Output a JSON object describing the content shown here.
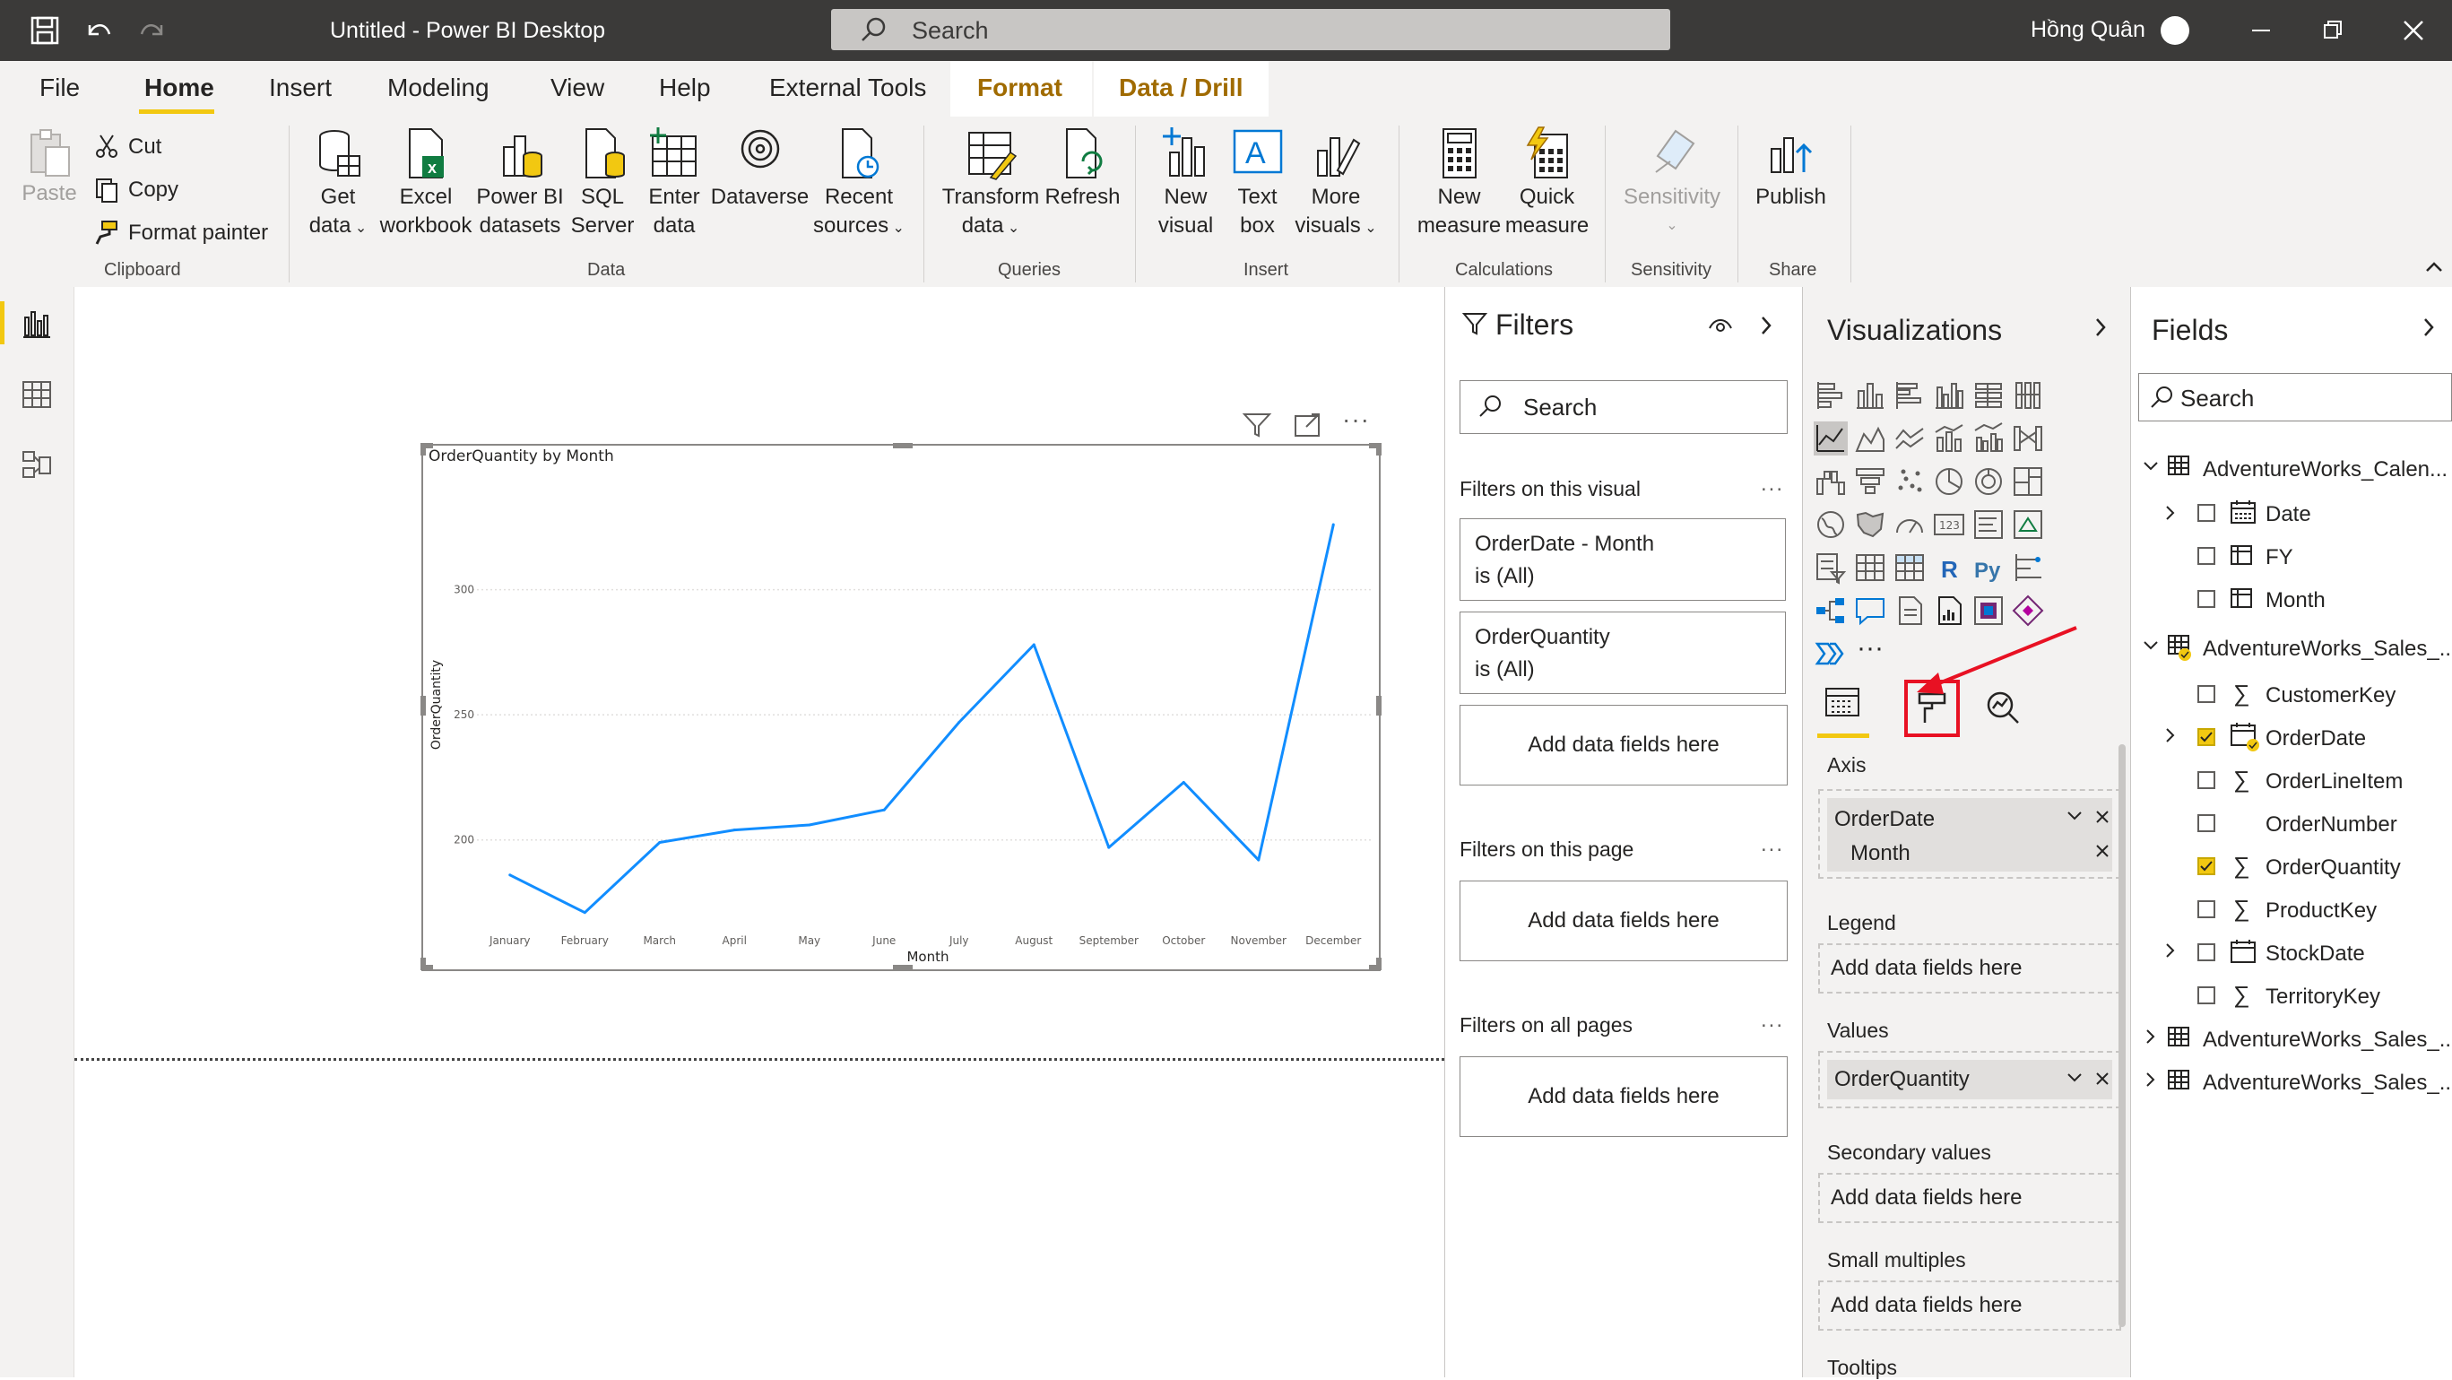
{
  "titlebar": {
    "title": "Untitled - Power BI Desktop",
    "search_placeholder": "Search",
    "user": "Hồng Quân"
  },
  "menu": {
    "tabs": [
      "File",
      "Home",
      "Insert",
      "Modeling",
      "View",
      "Help",
      "External Tools",
      "Format",
      "Data / Drill"
    ],
    "active": "Home"
  },
  "ribbon": {
    "clipboard": {
      "paste": "Paste",
      "cut": "Cut",
      "copy": "Copy",
      "format_painter": "Format painter",
      "group": "Clipboard"
    },
    "data": {
      "get_data_1": "Get",
      "get_data_2": "data",
      "excel_1": "Excel",
      "excel_2": "workbook",
      "pbi_1": "Power BI",
      "pbi_2": "datasets",
      "sql_1": "SQL",
      "sql_2": "Server",
      "enter_1": "Enter",
      "enter_2": "data",
      "dataverse": "Dataverse",
      "recent_1": "Recent",
      "recent_2": "sources",
      "group": "Data"
    },
    "queries": {
      "transform_1": "Transform",
      "transform_2": "data",
      "refresh": "Refresh",
      "group": "Queries"
    },
    "insert": {
      "new_1": "New",
      "new_2": "visual",
      "text_1": "Text",
      "text_2": "box",
      "more_1": "More",
      "more_2": "visuals",
      "group": "Insert"
    },
    "calculations": {
      "new_1": "New",
      "new_2": "measure",
      "quick_1": "Quick",
      "quick_2": "measure",
      "group": "Calculations"
    },
    "sensitivity": {
      "label": "Sensitivity",
      "group": "Sensitivity"
    },
    "share": {
      "publish": "Publish",
      "group": "Share"
    }
  },
  "chart_data": {
    "type": "line",
    "title": "OrderQuantity by Month",
    "xlabel": "Month",
    "ylabel": "OrderQuantity",
    "categories": [
      "January",
      "February",
      "March",
      "April",
      "May",
      "June",
      "July",
      "August",
      "September",
      "October",
      "November",
      "December"
    ],
    "series": [
      {
        "values": [
          186,
          171,
          199,
          204,
          206,
          212,
          247,
          278,
          197,
          223,
          192,
          326
        ]
      }
    ],
    "yticks": [
      200,
      250,
      300
    ],
    "ylim": [
      163,
      345
    ],
    "color": "#118dff"
  },
  "filters": {
    "title": "Filters",
    "search_placeholder": "Search",
    "on_visual": "Filters on this visual",
    "card1_line1": "OrderDate - Month",
    "card1_line2": "is (All)",
    "card2_line1": "OrderQuantity",
    "card2_line2": "is (All)",
    "add_fields": "Add data fields here",
    "on_page": "Filters on this page",
    "on_all": "Filters on all pages",
    "more": "..."
  },
  "visualizations": {
    "title": "Visualizations",
    "axis": "Axis",
    "axis_field": "OrderDate",
    "axis_sub": "Month",
    "legend": "Legend",
    "values": "Values",
    "values_field": "OrderQuantity",
    "secondary": "Secondary values",
    "small_multiples": "Small multiples",
    "tooltips": "Tooltips",
    "add_fields": "Add data fields here",
    "r_label": "R",
    "py_label": "Py",
    "num_label": "123"
  },
  "fields": {
    "title": "Fields",
    "search_placeholder": "Search",
    "tables": [
      {
        "name": "AdventureWorks_Calen...",
        "items": [
          "Date",
          "FY",
          "Month"
        ]
      },
      {
        "name": "AdventureWorks_Sales_...",
        "items": [
          "CustomerKey",
          "OrderDate",
          "OrderLineItem",
          "OrderNumber",
          "OrderQuantity",
          "ProductKey",
          "StockDate",
          "TerritoryKey"
        ]
      },
      {
        "name": "AdventureWorks_Sales_..."
      },
      {
        "name": "AdventureWorks_Sales_..."
      }
    ]
  },
  "colors": {
    "accent": "#f2c811",
    "annotation": "#e81123",
    "titlebar": "#3b3a39"
  }
}
